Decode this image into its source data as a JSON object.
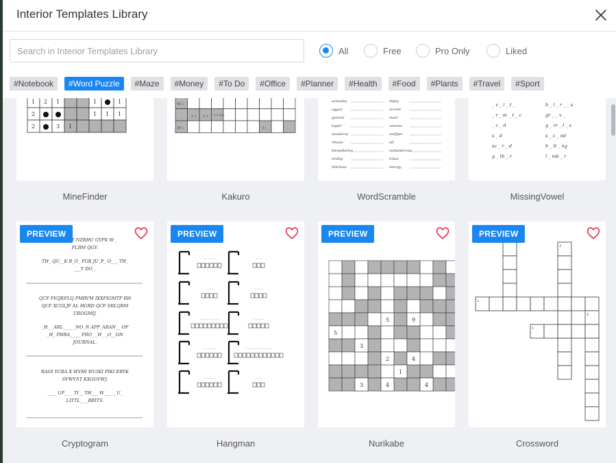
{
  "modal": {
    "title": "Interior Templates Library"
  },
  "search": {
    "placeholder": "Search in Interior Templates Library"
  },
  "filter_options": [
    {
      "label": "All",
      "selected": true
    },
    {
      "label": "Free",
      "selected": false
    },
    {
      "label": "Pro Only",
      "selected": false
    },
    {
      "label": "Liked",
      "selected": false
    }
  ],
  "tags": [
    {
      "label": "#Notebook",
      "active": false
    },
    {
      "label": "#Word Puzzle",
      "active": true
    },
    {
      "label": "#Maze",
      "active": false
    },
    {
      "label": "#Money",
      "active": false
    },
    {
      "label": "#To Do",
      "active": false
    },
    {
      "label": "#Office",
      "active": false
    },
    {
      "label": "#Planner",
      "active": false
    },
    {
      "label": "#Health",
      "active": false
    },
    {
      "label": "#Food",
      "active": false
    },
    {
      "label": "#Plants",
      "active": false
    },
    {
      "label": "#Travel",
      "active": false
    },
    {
      "label": "#Sport",
      "active": false
    }
  ],
  "templates_row1": [
    {
      "name": "MineFinder"
    },
    {
      "name": "Kakuro"
    },
    {
      "name": "WordScramble"
    },
    {
      "name": "MissingVowel"
    }
  ],
  "templates_row2": [
    {
      "name": "Cryptogram",
      "preview_label": "PREVIEW"
    },
    {
      "name": "Hangman",
      "preview_label": "PREVIEW"
    },
    {
      "name": "Nurikabe",
      "preview_label": "PREVIEW"
    },
    {
      "name": "Crossword",
      "preview_label": "PREVIEW"
    }
  ],
  "thumbs": {
    "minefinder_rows": [
      [
        "1",
        "2",
        "1",
        "",
        "",
        "1",
        "●",
        "1"
      ],
      [
        "2",
        "●",
        "●",
        "",
        "",
        "1",
        "1",
        "1"
      ],
      [
        "2",
        "●",
        "3",
        "1",
        "",
        "",
        "",
        ""
      ]
    ],
    "kakuro_clues": [
      "45 \\",
      "2 1",
      "3 1",
      "9 1 28 \\",
      "30 \\",
      "3 \\"
    ],
    "wordscramble_left": [
      "actividas",
      "eggen",
      "gemrat",
      "lappir",
      "wooderns",
      "ribuno",
      "biespidaries",
      "orebty",
      "tithrleau"
    ],
    "wordscramble_right": [
      "dipby",
      "arcode",
      "mael",
      "omenec",
      "eudfper",
      "alf",
      "outlanderoes",
      "trilao",
      "energy"
    ],
    "missingvowel_left": [
      "_ v _ l _ t _",
      "_ r _ m _ t _ c",
      "_ c _ d",
      "s _ d",
      "sc _ r _ d",
      "g _ th _ r"
    ],
    "missingvowel_right": [
      "h _ l _ r _ _ s",
      "gr _ _ v _",
      "g _ rr _ l _ s",
      "s _ c _ nd",
      "h _ lt _ ng",
      "l _ mb _ r"
    ],
    "cryptogram_lines": [
      "_ _C AGT NZRHU GYPX W_",
      "FLBM QGV.",
      "TH_ QU__K B_O_ FOX JU_P_ O___ TH_",
      "___Y DO_.",
      "QCF FIGJKFLQ PMRVM IXXFIGMTF RH",
      "QCF XCGLJF AL HGRD QCF SRLQRM",
      "UROGMIJ.",
      "_H_ _ARL____ _NO_N APP_ARAN__ OF",
      "_H_ PHRA__ __ FRO_ _H_ _O__ON",
      "JOURNAL.",
      "RAOI YCRA X WVHI WUIKI PIKI ERYK",
      "SVWVST KXGGVWJ.",
      "____ UP__ _ TI__ TH___ W___ __U_",
      "LITTL_ __BBITS."
    ],
    "hangman_blanks": [
      "- - - - - -",
      "- - -",
      "- - - -",
      "- - - -",
      "- - - - - - - - -",
      "- - - - -",
      "- - - - - -",
      "- - - - - - - - - - - -",
      "- - - - - -",
      "- - -"
    ],
    "nurikabe_numbers": [
      "5",
      "9",
      "5",
      "3",
      "2",
      "4",
      "1",
      "3",
      "4",
      "4"
    ],
    "crossword_numbers": [
      "3",
      "2",
      "5",
      "1"
    ]
  },
  "colors": {
    "accent": "#1a86f0",
    "heart": "#e8304a",
    "shade": "#b3b3b3"
  },
  "icons": {
    "close": "close-icon",
    "heart": "heart-icon"
  }
}
